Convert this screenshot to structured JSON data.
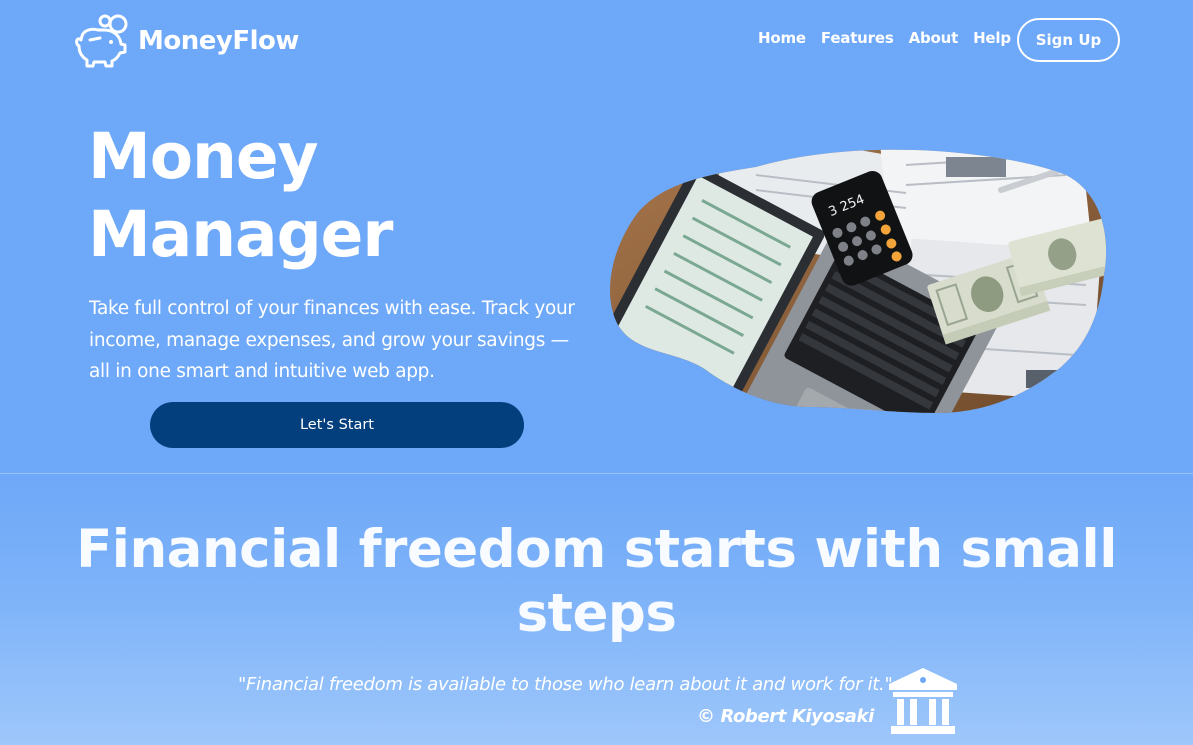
{
  "brand": {
    "name": "MoneyFlow",
    "logo_icon": "piggy-bank-icon"
  },
  "nav": {
    "links": [
      "Home",
      "Features",
      "About",
      "Help"
    ],
    "signup_label": "Sign Up"
  },
  "hero": {
    "title_line1": "Money",
    "title_line2": "Manager",
    "description": "Take full control of your finances with ease. Track your income, manage expenses, and grow your savings — all in one smart and intuitive web app.",
    "cta_label": "Let's Start",
    "image_subject": "laptop, calculator and dollar bills on desk",
    "calculator_display": "3 254"
  },
  "section": {
    "title": "Financial freedom starts with small steps",
    "quote": "\"Financial freedom is available to those who learn about it and work for it.\"",
    "author": "© Robert Kiyosaki",
    "icon": "bank-icon"
  },
  "colors": {
    "background": "#6ea8f8",
    "cta_button": "#033f7d",
    "text": "#ffffff"
  }
}
